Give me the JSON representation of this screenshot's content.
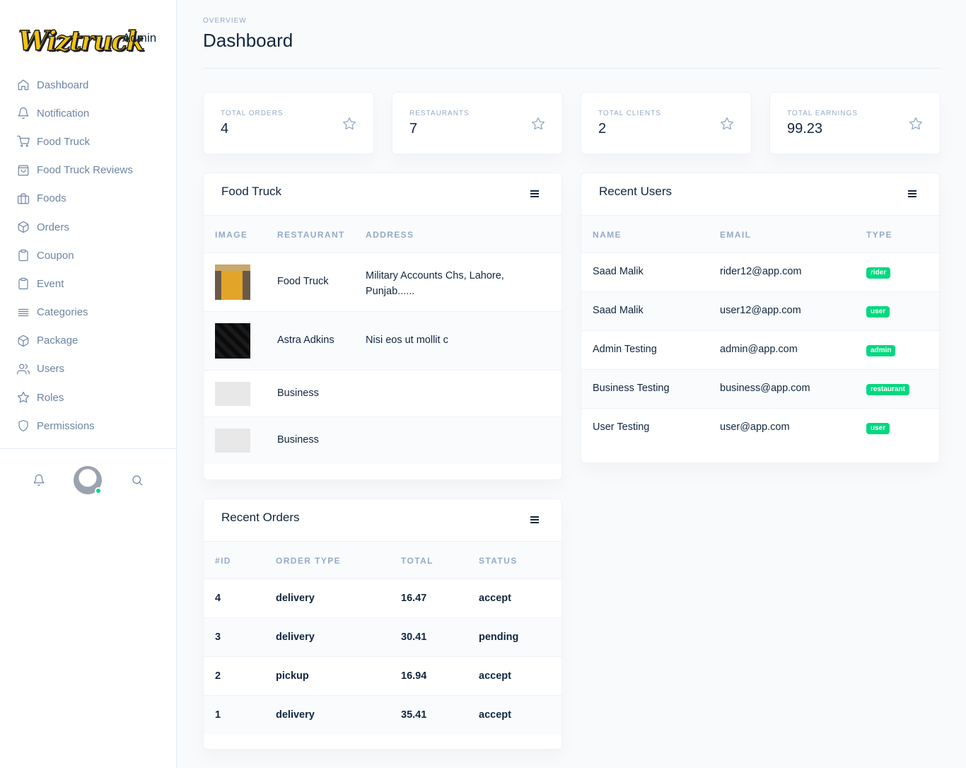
{
  "brand": {
    "logo_text": "Wiztruck",
    "admin_label": "Admin"
  },
  "sidebar": {
    "items": [
      {
        "label": "Dashboard",
        "icon": "home-icon"
      },
      {
        "label": "Notification",
        "icon": "bell-icon"
      },
      {
        "label": "Food Truck",
        "icon": "cart-icon"
      },
      {
        "label": "Food Truck Reviews",
        "icon": "shopping-bag-icon"
      },
      {
        "label": "Foods",
        "icon": "briefcase-icon"
      },
      {
        "label": "Orders",
        "icon": "box-icon"
      },
      {
        "label": "Coupon",
        "icon": "clipboard-icon"
      },
      {
        "label": "Event",
        "icon": "clipboard-icon"
      },
      {
        "label": "Categories",
        "icon": "list-icon"
      },
      {
        "label": "Package",
        "icon": "box-icon"
      },
      {
        "label": "Users",
        "icon": "users-icon"
      },
      {
        "label": "Roles",
        "icon": "star-icon"
      },
      {
        "label": "Permissions",
        "icon": "shield-icon"
      }
    ]
  },
  "header": {
    "pretitle": "OVERVIEW",
    "title": "Dashboard"
  },
  "stats": [
    {
      "label": "TOTAL ORDERS",
      "value": "4",
      "icon": "star-icon"
    },
    {
      "label": "RESTAURANTS",
      "value": "7",
      "icon": "star-icon"
    },
    {
      "label": "TOTAL CLIENTS",
      "value": "2",
      "icon": "star-icon"
    },
    {
      "label": "TOTAL EARNINGS",
      "value": "99.23",
      "icon": "star-icon"
    }
  ],
  "food_truck": {
    "title": "Food Truck",
    "columns": [
      "IMAGE",
      "RESTAURANT",
      "ADDRESS"
    ],
    "rows": [
      {
        "restaurant": "Food Truck",
        "address_line1": "Military Accounts Chs, Lahore,",
        "address_line2": "Punjab......"
      },
      {
        "restaurant": "Astra Adkins",
        "address_line1": "Nisi eos ut mollit c",
        "address_line2": ""
      },
      {
        "restaurant": "Business",
        "address_line1": "",
        "address_line2": ""
      },
      {
        "restaurant": "Business",
        "address_line1": "",
        "address_line2": ""
      }
    ]
  },
  "recent_users": {
    "title": "Recent Users",
    "columns": [
      "NAME",
      "EMAIL",
      "TYPE"
    ],
    "rows": [
      {
        "name": "Saad Malik",
        "email": "rider12@app.com",
        "type": "rider"
      },
      {
        "name": "Saad Malik",
        "email": "user12@app.com",
        "type": "user"
      },
      {
        "name": "Admin Testing",
        "email": "admin@app.com",
        "type": "admin"
      },
      {
        "name": "Business Testing",
        "email": "business@app.com",
        "type": "restaurant"
      },
      {
        "name": "User Testing",
        "email": "user@app.com",
        "type": "user"
      }
    ]
  },
  "recent_orders": {
    "title": "Recent Orders",
    "columns": [
      "#ID",
      "ORDER TYPE",
      "TOTAL",
      "STATUS"
    ],
    "rows": [
      {
        "id": "4",
        "type": "delivery",
        "total": "16.47",
        "status": "accept"
      },
      {
        "id": "3",
        "type": "delivery",
        "total": "30.41",
        "status": "pending"
      },
      {
        "id": "2",
        "type": "pickup",
        "total": "16.94",
        "status": "accept"
      },
      {
        "id": "1",
        "type": "delivery",
        "total": "35.41",
        "status": "accept"
      }
    ]
  },
  "colors": {
    "accent_green": "#00d97e",
    "muted": "#95aac9",
    "text": "#12263f",
    "logo_yellow": "#f2c313"
  }
}
